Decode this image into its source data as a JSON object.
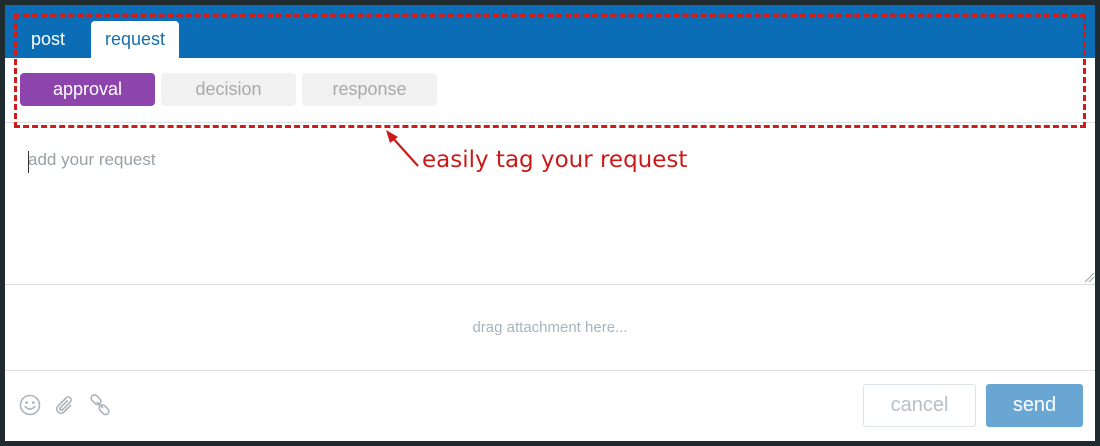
{
  "tabs": [
    {
      "label": "post",
      "active": false
    },
    {
      "label": "request",
      "active": true
    }
  ],
  "tags": [
    {
      "label": "approval",
      "selected": true,
      "color": "#8e44ad"
    },
    {
      "label": "decision",
      "selected": false
    },
    {
      "label": "response",
      "selected": false
    }
  ],
  "request": {
    "placeholder": "add your request",
    "value": ""
  },
  "attachment": {
    "hint": "drag attachment here..."
  },
  "toolbar": {
    "icons": [
      "smiley-icon",
      "paperclip-icon",
      "link-icon"
    ]
  },
  "actions": {
    "cancel_label": "cancel",
    "send_label": "send"
  },
  "annotation": {
    "text": "easily tag your request",
    "color": "#d11a1a"
  },
  "colors": {
    "header": "#0b6db5",
    "send": "#6aa6d3"
  }
}
